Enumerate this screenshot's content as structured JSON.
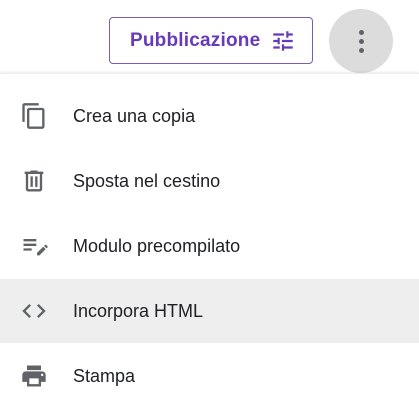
{
  "header": {
    "publish_label": "Pubblicazione",
    "publish_icon": "tune-icon",
    "more_icon": "more-vert-icon"
  },
  "menu": {
    "items": [
      {
        "label": "Crea una copia",
        "icon": "copy-icon"
      },
      {
        "label": "Sposta nel cestino",
        "icon": "trash-icon"
      },
      {
        "label": "Modulo precompilato",
        "icon": "edit-note-icon"
      },
      {
        "label": "Incorpora HTML",
        "icon": "code-icon",
        "highlighted": true
      },
      {
        "label": "Stampa",
        "icon": "print-icon"
      }
    ]
  },
  "colors": {
    "accent": "#673ab7",
    "icon": "#5f6368",
    "text": "#202124",
    "hover": "#eeeeee"
  }
}
